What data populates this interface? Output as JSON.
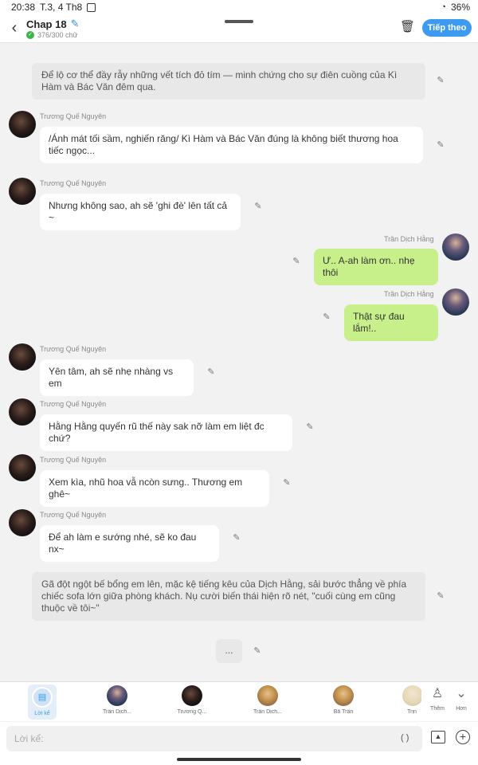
{
  "status": {
    "time": "20:38",
    "date": "T.3, 4 Th8",
    "battery": "36%"
  },
  "header": {
    "title": "Chap 18",
    "wordcount": "376/300 chữ",
    "next_label": "Tiếp theo"
  },
  "messages": {
    "narr1": "Để lộ cơ thể đầy rẫy những vết tích đỏ tím — minh chứng cho sự điên cuồng của Kì Hàm và Bác Văn đêm qua.",
    "m1_name": "Trương Quế Nguyên",
    "m1_text": "/Ánh mát tối sầm, nghiến răng/ Kì Hàm và Bác Văn đúng là không biết thương hoa tiếc ngọc...",
    "m2_name": "Trương Quế Nguyên",
    "m2_text": "Nhưng không sao, ah sẽ 'ghi đè' lên tất cả ~",
    "m3_name": "Trần Dịch Hằng",
    "m3_text": "Ư.. A-ah làm ơn.. nhẹ thôi",
    "m4_name": "Trần Dịch Hằng",
    "m4_text": "Thật sự đau lắm!..",
    "m5_name": "Trương Quế Nguyên",
    "m5_text": "Yên tâm, ah sẽ nhẹ nhàng vs em",
    "m6_name": "Trương Quế Nguyên",
    "m6_text": "Hằng Hằng quyến rũ thế này sak nỡ làm em liệt đc chứ?",
    "m7_name": "Trương Quế Nguyên",
    "m7_text": "Xem kìa, nhũ hoa vẫ ncòn sưng.. Thương em ghê~",
    "m8_name": "Trương Quế Nguyên",
    "m8_text": "Để ah làm e sướng nhé, sẽ ko đau nx~",
    "narr2": "Gã đột ngột bế bổng em lên, mặc kệ tiếng kêu của Dịch Hằng, sải bước thẳng về phía chiếc sofa lớn giữa phòng khách. Nụ cười biến thái hiện rõ nét, \"cuối cùng em cũng thuộc về tôi~\"",
    "dots": "..."
  },
  "charbar": {
    "active_label": "Lời kể",
    "c1": "Trần Dịch...",
    "c2": "Trương Q...",
    "c3": "Trần Dịch...",
    "c4": "Bã Trần",
    "c5": "Trịn",
    "add_label": "Thêm",
    "more_label": "Hơn"
  },
  "input": {
    "placeholder": "Lời kể:",
    "paren": "( )"
  },
  "icons": [
    "back-icon",
    "edit-icon",
    "check-icon",
    "trash-icon",
    "narration-icon",
    "add-person-icon",
    "chevron-down-icon",
    "image-icon",
    "plus-icon"
  ]
}
